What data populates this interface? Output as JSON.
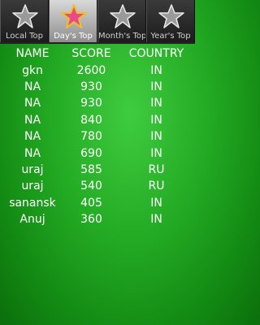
{
  "tabs": [
    {
      "label": "Local Top",
      "icon": "star-grey-icon",
      "active": false
    },
    {
      "label": "Day's Top",
      "icon": "star-pink-icon",
      "active": true
    },
    {
      "label": "Month's Top",
      "icon": "star-grey-icon",
      "active": false
    },
    {
      "label": "Year's Top",
      "icon": "star-grey-icon",
      "active": false
    }
  ],
  "colors": {
    "background": "#22a822",
    "active_star": "#e84a8a",
    "active_star_outline": "#f0c020",
    "inactive_star": "#9a9a9a"
  },
  "table": {
    "headers": [
      "NAME",
      "SCORE",
      "COUNTRY"
    ],
    "rows": [
      [
        "gkn",
        "2600",
        "IN"
      ],
      [
        "NA",
        "930",
        "IN"
      ],
      [
        "NA",
        "930",
        "IN"
      ],
      [
        "NA",
        "840",
        "IN"
      ],
      [
        "NA",
        "780",
        "IN"
      ],
      [
        "NA",
        "690",
        "IN"
      ],
      [
        "uraj",
        "585",
        "RU"
      ],
      [
        "uraj",
        "540",
        "RU"
      ],
      [
        "sanansk",
        "405",
        "IN"
      ],
      [
        "Anuj",
        "360",
        "IN"
      ]
    ]
  }
}
